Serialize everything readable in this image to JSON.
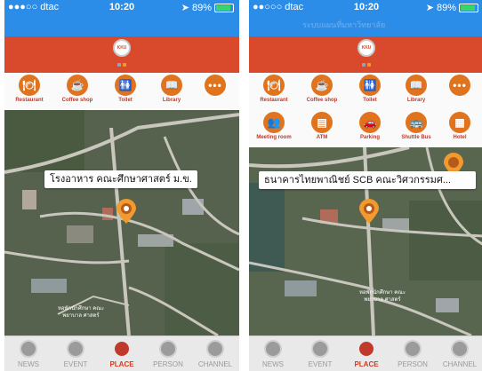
{
  "colors": {
    "status_blue": "#2c8de9",
    "header_red": "#d94a2c",
    "accent_orange": "#e0731e",
    "active_tab": "#d63a1f"
  },
  "screens": [
    {
      "status": {
        "carrier": "●●●○○ dtac",
        "time": "10:20",
        "battery": "89%",
        "battery_level": 0.89
      },
      "logo_text": "KKU",
      "categories_row1": [
        {
          "label": "Restaurant",
          "icon": "restaurant-icon"
        },
        {
          "label": "Coffee shop",
          "icon": "coffee-icon"
        },
        {
          "label": "Toilet",
          "icon": "toilet-icon"
        },
        {
          "label": "Library",
          "icon": "library-icon"
        },
        {
          "label": "",
          "icon": "more-icon"
        }
      ],
      "callout": "โรงอาหาร คณะศึกษาศาสตร์ ม.ข.",
      "watermark": "หอพักนักศึกษา คณะพยาบาล ศาสตร์",
      "tabs": [
        {
          "label": "NEWS",
          "icon": "news-icon",
          "active": false
        },
        {
          "label": "EVENT",
          "icon": "event-icon",
          "active": false
        },
        {
          "label": "PLACE",
          "icon": "place-icon",
          "active": true
        },
        {
          "label": "PERSON",
          "icon": "person-icon",
          "active": false
        },
        {
          "label": "CHANNEL",
          "icon": "channel-icon",
          "active": false
        }
      ]
    },
    {
      "status": {
        "carrier": "●●○○○ dtac",
        "time": "10:20",
        "battery": "89%",
        "battery_level": 0.89
      },
      "logo_text": "KKU",
      "header_ghost_text": "ระบบแผนที่มหาวิทยาลัย",
      "categories_row1": [
        {
          "label": "Restaurant",
          "icon": "restaurant-icon"
        },
        {
          "label": "Coffee shop",
          "icon": "coffee-icon"
        },
        {
          "label": "Toilet",
          "icon": "toilet-icon"
        },
        {
          "label": "Library",
          "icon": "library-icon"
        },
        {
          "label": "",
          "icon": "more-icon"
        }
      ],
      "categories_row2": [
        {
          "label": "Meeting room",
          "icon": "meeting-icon"
        },
        {
          "label": "ATM",
          "icon": "atm-icon"
        },
        {
          "label": "Parking",
          "icon": "parking-icon"
        },
        {
          "label": "Shuttle Bus",
          "icon": "bus-icon"
        },
        {
          "label": "Hotel",
          "icon": "hotel-icon"
        }
      ],
      "callout": "ธนาคารไทยพาณิชย์ SCB คณะวิศวกรรมศ...",
      "watermark": "หอพักนักศึกษา คณะพยาบาล ศาสตร์",
      "tabs": [
        {
          "label": "NEWS",
          "icon": "news-icon",
          "active": false
        },
        {
          "label": "EVENT",
          "icon": "event-icon",
          "active": false
        },
        {
          "label": "PLACE",
          "icon": "place-icon",
          "active": true
        },
        {
          "label": "PERSON",
          "icon": "person-icon",
          "active": false
        },
        {
          "label": "CHANNEL",
          "icon": "channel-icon",
          "active": false
        }
      ]
    }
  ]
}
